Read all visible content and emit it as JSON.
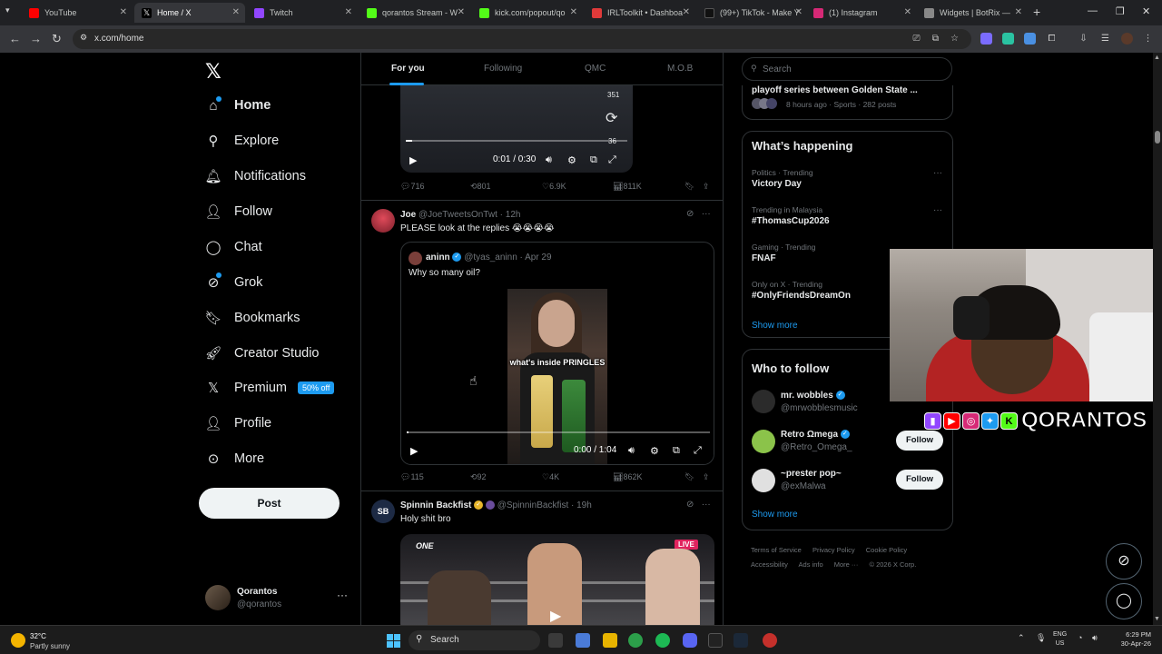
{
  "browser": {
    "tabs": [
      {
        "label": "YouTube",
        "color": "#ff0000"
      },
      {
        "label": "Home / X",
        "color": "#ffffff"
      },
      {
        "label": "Twitch",
        "color": "#9146ff"
      },
      {
        "label": "qorantos Stream - W",
        "color": "#53fc18"
      },
      {
        "label": "kick.com/popout/qo",
        "color": "#53fc18"
      },
      {
        "label": "IRLToolkit • Dashboa",
        "color": "#e03a3a"
      },
      {
        "label": "(99+) TikTok - Make Y",
        "color": "#111111"
      },
      {
        "label": "(1) Instagram",
        "color": "#d62976"
      },
      {
        "label": "Widgets | BotRix —",
        "color": "#888888"
      }
    ],
    "url": "x.com/home"
  },
  "nav": {
    "home": "Home",
    "explore": "Explore",
    "notifications": "Notifications",
    "follow": "Follow",
    "chat": "Chat",
    "grok": "Grok",
    "bookmarks": "Bookmarks",
    "creator_studio": "Creator Studio",
    "premium": "Premium",
    "premium_badge": "50% off",
    "profile": "Profile",
    "more": "More",
    "post": "Post"
  },
  "account": {
    "name": "Qorantos",
    "handle": "@qorantos"
  },
  "feed_tabs": [
    "For you",
    "Following",
    "QMC",
    "M.O.B"
  ],
  "top_video": {
    "count_top": "351",
    "count_bottom": "36",
    "time": "0:01 / 0:30",
    "progress": 0.03
  },
  "top_actions": {
    "replies": "716",
    "reposts": "801",
    "likes": "6.9K",
    "views": "811K"
  },
  "tweet1": {
    "name": "Joe",
    "handle": "@JoeTweetsOnTwt · 12h",
    "text": "PLEASE look at the replies 😭😭😭😭",
    "quote": {
      "name": "aninn",
      "handle": "@tyas_aninn · Apr 29",
      "text": "Why so many oil?",
      "caption": "what's inside PRINGLES",
      "time": "0:00 / 1:04",
      "progress": 0.0
    },
    "actions": {
      "replies": "115",
      "reposts": "92",
      "likes": "4K",
      "views": "862K"
    }
  },
  "tweet2": {
    "name": "Spinnin Backfist",
    "handle": "@SpinninBackfist · 19h",
    "text": "Holy shit bro",
    "brand": "ONE",
    "live": "LIVE"
  },
  "right": {
    "search_placeholder": "Search",
    "top_trend": {
      "name": "playoff series between Golden State ...",
      "meta": "8 hours ago · Sports · 282 posts"
    },
    "happening_title": "What’s happening",
    "trends": [
      {
        "category": "Politics · Trending",
        "name": "Victory Day"
      },
      {
        "category": "Trending in Malaysia",
        "name": "#ThomasCup2026"
      },
      {
        "category": "Gaming · Trending",
        "name": "FNAF"
      },
      {
        "category": "Only on X · Trending",
        "name": "#OnlyFriendsDreamOn"
      }
    ],
    "show_more": "Show more",
    "who_to_follow_title": "Who to follow",
    "follow_label": "Follow",
    "suggestions": [
      {
        "name": "mr. wobbles",
        "handle": "@mrwobblesmusic"
      },
      {
        "name": "Retro Ωmega",
        "handle": "@Retro_Omega_"
      },
      {
        "name": "~prester pop~",
        "handle": "@exMalwa"
      }
    ],
    "footer": [
      "Terms of Service",
      "Privacy Policy",
      "Cookie Policy",
      "Accessibility",
      "Ads info",
      "More ···",
      "© 2026 X Corp."
    ]
  },
  "overlay": {
    "streamer_name": "QORANTOS"
  },
  "taskbar": {
    "temp": "32°C",
    "weather": "Partly sunny",
    "search": "Search",
    "lang": "ENG",
    "region": "US",
    "time": "6:29 PM",
    "date": "30-Apr-26"
  }
}
